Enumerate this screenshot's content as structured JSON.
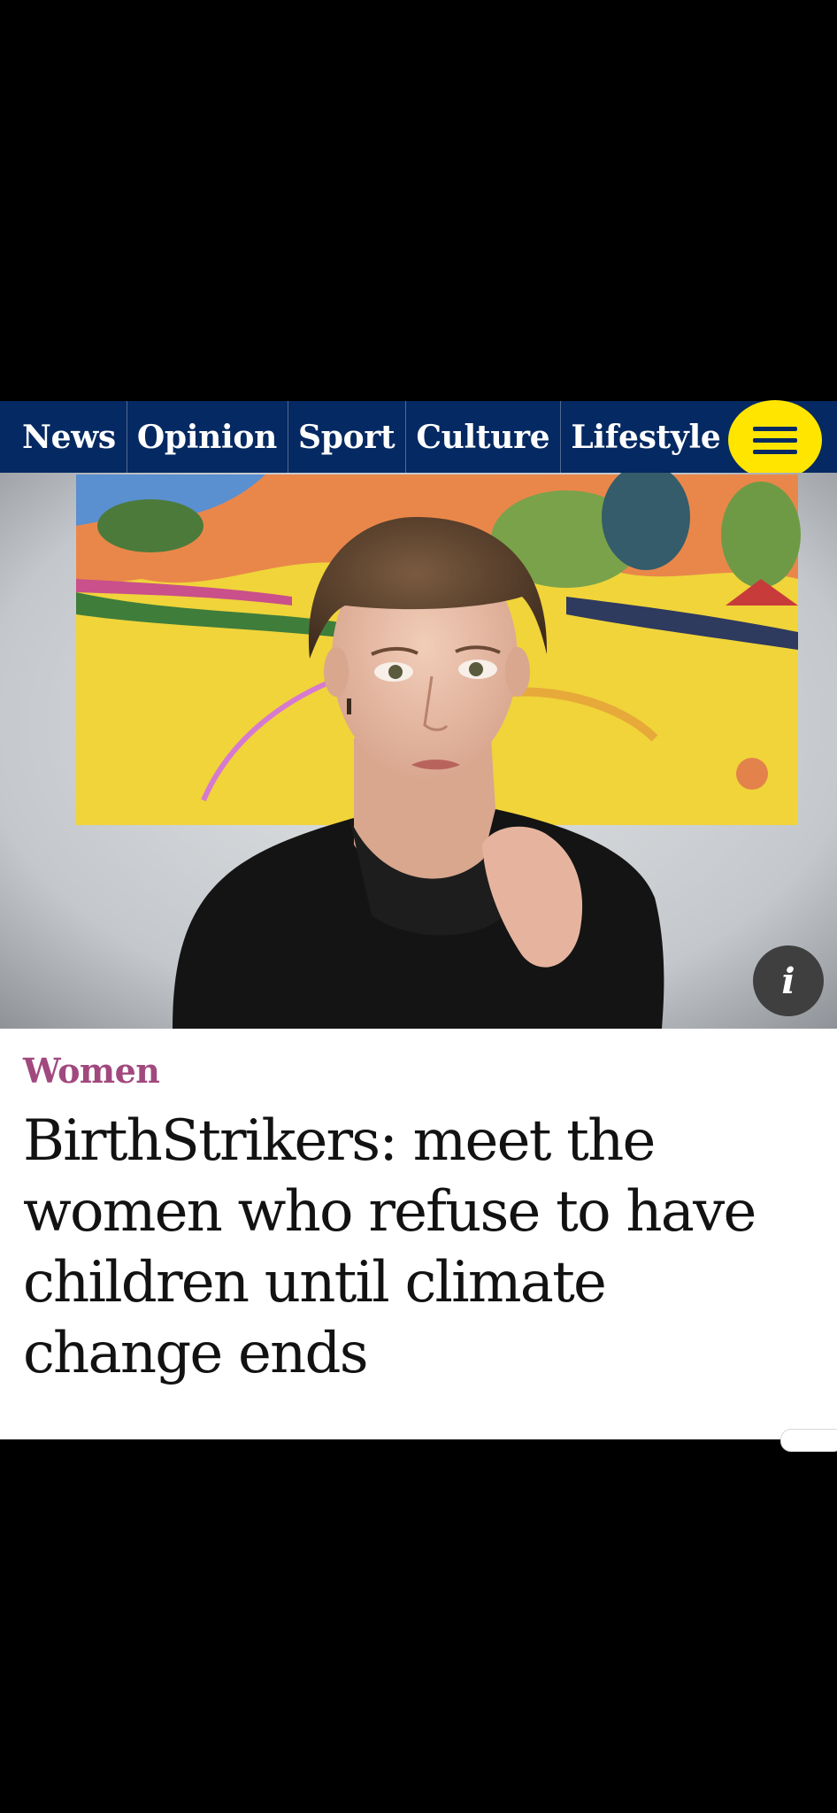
{
  "nav": {
    "items": [
      "News",
      "Opinion",
      "Sport",
      "Culture",
      "Lifestyle"
    ],
    "menu_icon": "hamburger-menu-icon",
    "bg_color": "#052962",
    "menu_color": "#ffe500"
  },
  "hero": {
    "info_label": "i",
    "info_icon": "info-icon"
  },
  "article": {
    "kicker": "Women",
    "kicker_color": "#a1497e",
    "headline": "BirthStrikers: meet the women who refuse to have children until climate change ends"
  }
}
